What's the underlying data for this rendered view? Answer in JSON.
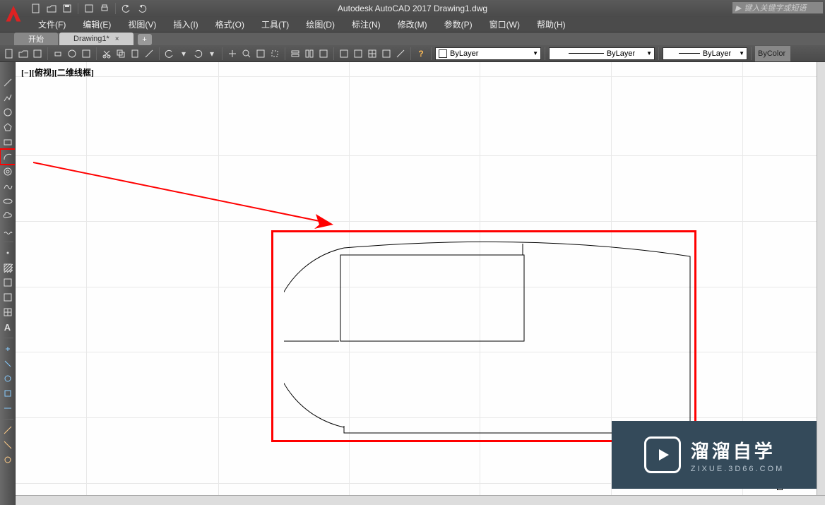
{
  "title": "Autodesk AutoCAD 2017   Drawing1.dwg",
  "search_placeholder": "键入关键字或短语",
  "menu": [
    {
      "label": "文件(F)"
    },
    {
      "label": "编辑(E)"
    },
    {
      "label": "视图(V)"
    },
    {
      "label": "插入(I)"
    },
    {
      "label": "格式(O)"
    },
    {
      "label": "工具(T)"
    },
    {
      "label": "绘图(D)"
    },
    {
      "label": "标注(N)"
    },
    {
      "label": "修改(M)"
    },
    {
      "label": "参数(P)"
    },
    {
      "label": "窗口(W)"
    },
    {
      "label": "帮助(H)"
    }
  ],
  "tabs": [
    {
      "label": "开始",
      "active": false
    },
    {
      "label": "Drawing1*",
      "active": true
    }
  ],
  "qat_icons": [
    "new-icon",
    "open-icon",
    "save-icon",
    "saveas-icon",
    "print-icon",
    "undo-icon",
    "redo-icon"
  ],
  "toolbar_icons_left": [
    "new-icon",
    "open-icon",
    "save-icon",
    "print-icon",
    "print-preview-icon",
    "publish-icon",
    "cut-icon",
    "copy-icon",
    "paste-icon",
    "match-icon",
    "undo-icon",
    "redo-icon",
    "pan-icon",
    "zoom-icon",
    "zoom-ext-icon",
    "zoom-win-icon",
    "layer-icon",
    "lstate-icon",
    "lprev-icon",
    "prop-icon",
    "block-icon",
    "table-icon",
    "clip-icon",
    "measure-icon",
    "help-icon"
  ],
  "dropdowns": {
    "layer": "ByLayer",
    "linetype": "ByLayer",
    "lineweight": "ByLayer",
    "color": "ByColor"
  },
  "left_tools": [
    {
      "name": "line-icon"
    },
    {
      "name": "pline-icon"
    },
    {
      "name": "circle-icon"
    },
    {
      "name": "polygon-icon"
    },
    {
      "name": "rectangle-icon"
    },
    {
      "name": "arc-icon",
      "highlighted": true
    },
    {
      "name": "donut-icon"
    },
    {
      "name": "spline-icon"
    },
    {
      "name": "ellipse-icon"
    },
    {
      "name": "cloud-icon"
    },
    {
      "name": "revcloud-icon"
    },
    {
      "name": "sep"
    },
    {
      "name": "point-icon"
    },
    {
      "name": "hatch-icon"
    },
    {
      "name": "gradient-icon"
    },
    {
      "name": "region-icon"
    },
    {
      "name": "table-icon"
    },
    {
      "name": "text-A-icon"
    },
    {
      "name": "sep"
    },
    {
      "name": "mod1-icon"
    },
    {
      "name": "mod2-icon"
    },
    {
      "name": "mod3-icon"
    },
    {
      "name": "mod4-icon"
    },
    {
      "name": "mod5-icon"
    },
    {
      "name": "sep"
    },
    {
      "name": "mod6-icon"
    },
    {
      "name": "mod7-icon"
    },
    {
      "name": "mod8-icon"
    }
  ],
  "view_label_prefix": "[−][俯视][",
  "view_label_link": "二维线框",
  "view_label_suffix": "]",
  "watermark": {
    "title": "溜溜自学",
    "sub": "ZIXUE.3D66.COM"
  },
  "grid": {
    "vx": [
      100,
      287,
      472,
      657,
      843,
      1029
    ],
    "hy": [
      20,
      132,
      225,
      318,
      410,
      503,
      596
    ]
  }
}
